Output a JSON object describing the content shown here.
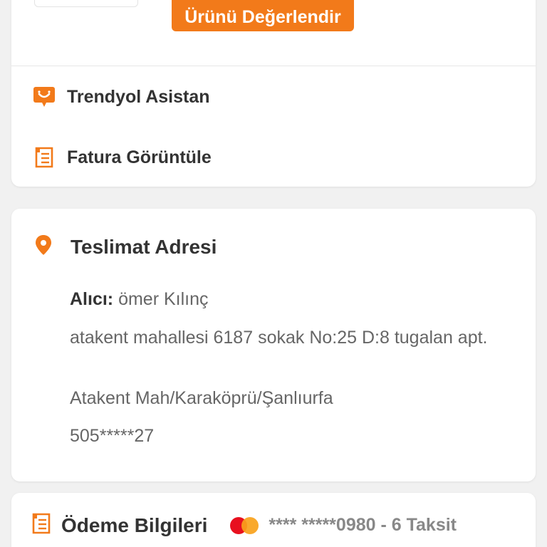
{
  "order_actions": {
    "rate_button_label": "Ürünü Değerlendir",
    "assistant_label": "Trendyol Asistan",
    "invoice_label": "Fatura Görüntüle"
  },
  "delivery_address": {
    "title": "Teslimat Adresi",
    "recipient_label": "Alıcı:",
    "recipient_name": "ömer Kılınç",
    "street": "atakent mahallesi 6187 sokak No:25 D:8 tugalan apt.",
    "district_city": "Atakent Mah/Karaköprü/Şanlıurfa",
    "phone": "505*****27"
  },
  "payment": {
    "title": "Ödeme Bilgileri",
    "card_brand_icon": "mastercard-icon",
    "card_info": "**** *****0980 - 6 Taksit"
  },
  "colors": {
    "accent": "#f27a1a",
    "background": "#f1f1f1",
    "card": "#ffffff"
  }
}
